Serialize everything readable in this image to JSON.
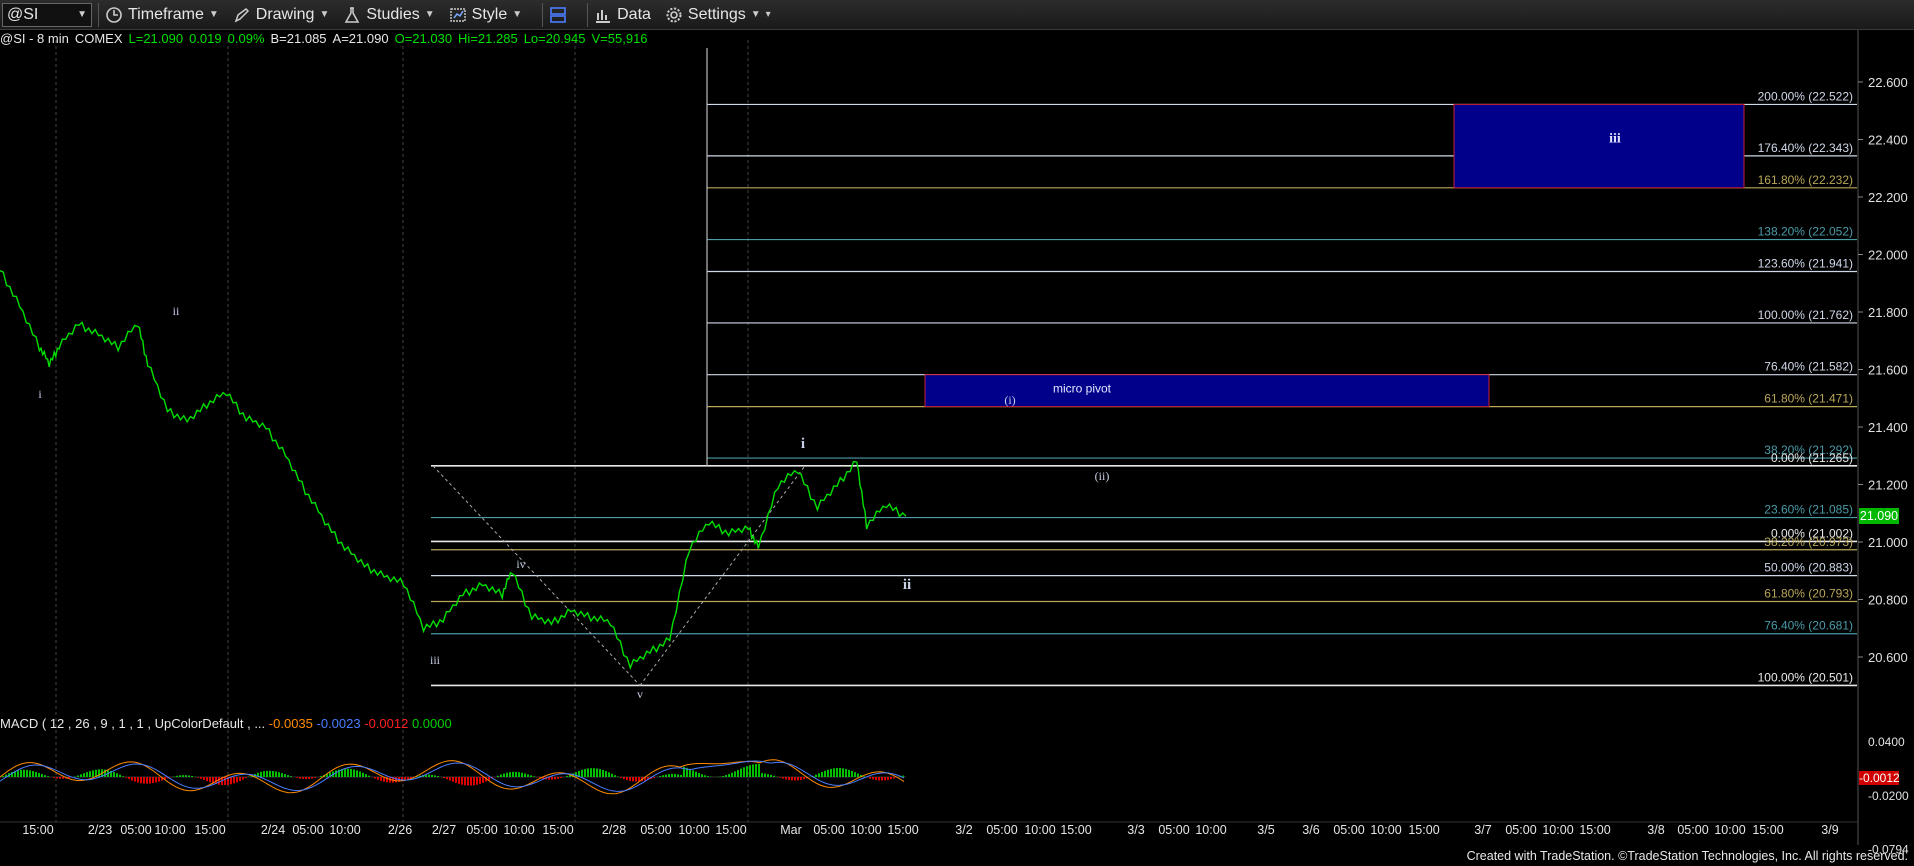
{
  "toolbar": {
    "symbol": "@SI",
    "timeframe": "Timeframe",
    "drawing": "Drawing",
    "studies": "Studies",
    "style": "Style",
    "data": "Data",
    "settings": "Settings"
  },
  "status": {
    "symbol": "@SI - 8 min",
    "exchange": "COMEX",
    "last": "L=21.090",
    "change": "0.019",
    "pct": "0.09%",
    "bid": "B=21.085",
    "ask": "A=21.090",
    "open": "O=21.030",
    "high": "Hi=21.285",
    "low": "Lo=20.945",
    "volume": "V=55,916"
  },
  "macd": {
    "label": "MACD ( 12 , 26 , 9 , 1 , 1 , UpColorDefault , ...",
    "v1": "-0.0035",
    "v2": "-0.0023",
    "v3": "-0.0012",
    "v4": "0.0000",
    "badge": "-0.0012",
    "ticks": [
      {
        "v": 0.04,
        "t": "0.0400"
      },
      {
        "v": -0.02,
        "t": "-0.0200"
      },
      {
        "v": -0.0794,
        "t": "-0.0794"
      }
    ]
  },
  "price_badge": "21.090",
  "footer": "Created with TradeStation. ©TradeStation Technologies, Inc. All rights reserved.",
  "colors": {
    "price": "#00e000",
    "background": "#000000",
    "box": "#00008b",
    "macd": "#ff8c00",
    "signal": "#4a7dff"
  },
  "chart_data": {
    "type": "line",
    "title": "@SI - 8 min",
    "ylim": [
      20.45,
      22.75
    ],
    "y_ticks": [
      22.6,
      22.4,
      22.2,
      22.0,
      21.8,
      21.6,
      21.4,
      21.2,
      21.0,
      20.8,
      20.6
    ],
    "x_ticks": [
      "15:00",
      "2/23",
      "05:00",
      "10:00",
      "15:00",
      "2/24",
      "05:00",
      "10:00",
      "2/26",
      "2/27",
      "05:00",
      "10:00",
      "15:00",
      "2/28",
      "05:00",
      "10:00",
      "15:00",
      "Mar",
      "05:00",
      "10:00",
      "15:00",
      "3/2",
      "05:00",
      "10:00",
      "15:00",
      "3/3",
      "05:00",
      "10:00",
      "3/5",
      "3/6",
      "05:00",
      "10:00",
      "15:00",
      "3/7",
      "05:00",
      "10:00",
      "15:00",
      "3/8",
      "05:00",
      "10:00",
      "15:00",
      "3/9"
    ],
    "price_series": [
      {
        "t": 0,
        "y": 21.95
      },
      {
        "t": 2,
        "y": 21.82
      },
      {
        "t": 4,
        "y": 21.68
      },
      {
        "t": 5,
        "y": 21.62
      },
      {
        "t": 6,
        "y": 21.68
      },
      {
        "t": 8,
        "y": 21.76
      },
      {
        "t": 10,
        "y": 21.72
      },
      {
        "t": 12,
        "y": 21.68
      },
      {
        "t": 14,
        "y": 21.76
      },
      {
        "t": 15,
        "y": 21.62
      },
      {
        "t": 17,
        "y": 21.46
      },
      {
        "t": 19,
        "y": 21.42
      },
      {
        "t": 21,
        "y": 21.48
      },
      {
        "t": 23,
        "y": 21.52
      },
      {
        "t": 25,
        "y": 21.43
      },
      {
        "t": 27,
        "y": 21.4
      },
      {
        "t": 29,
        "y": 21.3
      },
      {
        "t": 31,
        "y": 21.18
      },
      {
        "t": 33,
        "y": 21.07
      },
      {
        "t": 35,
        "y": 20.98
      },
      {
        "t": 37,
        "y": 20.92
      },
      {
        "t": 39,
        "y": 20.88
      },
      {
        "t": 41,
        "y": 20.86
      },
      {
        "t": 43,
        "y": 20.7
      },
      {
        "t": 45,
        "y": 20.73
      },
      {
        "t": 47,
        "y": 20.82
      },
      {
        "t": 49,
        "y": 20.85
      },
      {
        "t": 51,
        "y": 20.82
      },
      {
        "t": 52,
        "y": 20.9
      },
      {
        "t": 54,
        "y": 20.74
      },
      {
        "t": 56,
        "y": 20.72
      },
      {
        "t": 58,
        "y": 20.76
      },
      {
        "t": 60,
        "y": 20.74
      },
      {
        "t": 62,
        "y": 20.72
      },
      {
        "t": 64,
        "y": 20.57
      },
      {
        "t": 66,
        "y": 20.62
      },
      {
        "t": 68,
        "y": 20.66
      },
      {
        "t": 70,
        "y": 20.98
      },
      {
        "t": 72,
        "y": 21.07
      },
      {
        "t": 74,
        "y": 21.03
      },
      {
        "t": 76,
        "y": 21.05
      },
      {
        "t": 77,
        "y": 20.98
      },
      {
        "t": 79,
        "y": 21.2
      },
      {
        "t": 81,
        "y": 21.25
      },
      {
        "t": 83,
        "y": 21.12
      },
      {
        "t": 85,
        "y": 21.2
      },
      {
        "t": 87,
        "y": 21.28
      },
      {
        "t": 88,
        "y": 21.06
      },
      {
        "t": 90,
        "y": 21.13
      },
      {
        "t": 92,
        "y": 21.09
      }
    ],
    "fib_levels": [
      {
        "pct": "200.00%",
        "v": 22.522,
        "label": "200.00% (22.522)",
        "color": "#cfd8e8"
      },
      {
        "pct": "176.40%",
        "v": 22.343,
        "label": "176.40% (22.343)",
        "color": "#cfd8e8"
      },
      {
        "pct": "161.80%",
        "v": 22.232,
        "label": "161.80% (22.232)",
        "color": "#b9a658"
      },
      {
        "pct": "138.20%",
        "v": 22.052,
        "label": "138.20% (22.052)",
        "color": "#4a9aa8"
      },
      {
        "pct": "123.60%",
        "v": 21.941,
        "label": "123.60% (21.941)",
        "color": "#cfd8e8"
      },
      {
        "pct": "100.00%",
        "v": 21.762,
        "label": "100.00% (21.762)",
        "color": "#cfd8e8"
      },
      {
        "pct": "76.40%",
        "v": 21.582,
        "label": "76.40% (21.582)",
        "color": "#cfd8e8"
      },
      {
        "pct": "61.80%",
        "v": 21.471,
        "label": "61.80% (21.471)",
        "color": "#b9a658"
      },
      {
        "pct": "38.20%",
        "v": 21.292,
        "label": "38.20% (21.292)",
        "color": "#4a9aa8"
      },
      {
        "pct": "0.00%",
        "v": 21.265,
        "label": "0.00% (21.265)",
        "color": "#e8e8e8"
      },
      {
        "pct": "23.60%",
        "v": 21.085,
        "label": "23.60% (21.085)",
        "color": "#4a9aa8"
      },
      {
        "pct": "0.00%",
        "v": 21.002,
        "label": "0.00% (21.002)",
        "color": "#e8e8e8"
      },
      {
        "pct": "38.20%",
        "v": 20.973,
        "label": "38.20% (20.973)",
        "color": "#b9a658"
      },
      {
        "pct": "50.00%",
        "v": 20.883,
        "label": "50.00% (20.883)",
        "color": "#cfd8e8"
      },
      {
        "pct": "61.80%",
        "v": 20.793,
        "label": "61.80% (20.793)",
        "color": "#b9a658"
      },
      {
        "pct": "76.40%",
        "v": 20.681,
        "label": "76.40% (20.681)",
        "color": "#4a9aa8"
      },
      {
        "pct": "100.00%",
        "v": 20.501,
        "label": "100.00% (20.501)",
        "color": "#e8e8e8"
      }
    ],
    "boxes": [
      {
        "label": "iii",
        "y_top": 22.522,
        "y_bottom": 22.232
      },
      {
        "label": "micro pivot",
        "y_top": 21.582,
        "y_bottom": 21.471
      }
    ],
    "wave_labels": [
      "i",
      "ii",
      "iii",
      "iv",
      "v",
      "i",
      "ii",
      "(i)",
      "(ii)"
    ]
  }
}
